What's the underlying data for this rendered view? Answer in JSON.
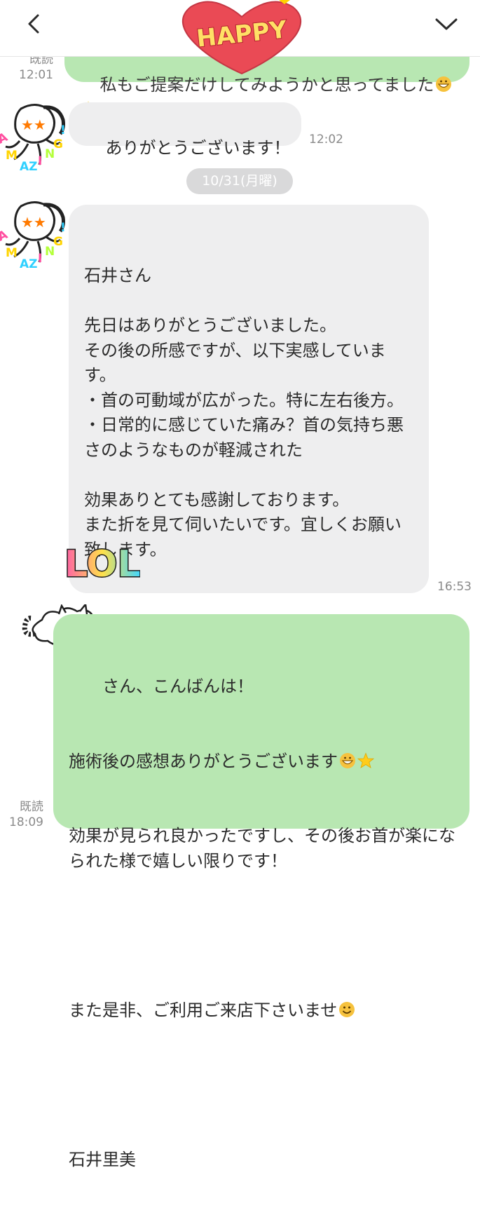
{
  "header": {
    "sticker_text": "HAPPY"
  },
  "messages": {
    "m0": {
      "text": "私もご提案だけしてみようかと思ってました",
      "read": "既読",
      "time": "12:01"
    },
    "m1": {
      "text": "ありがとうございます！",
      "time": "12:02"
    },
    "date_separator": "10/31(月曜)",
    "m2": {
      "text": "石井さん\n\n先日はありがとうございました。\nその後の所感ですが、以下実感しています。\n・首の可動域が広がった。特に左右後方。\n・日常的に感じていた痛み？首の気持ち悪さのようなものが軽減された\n\n効果ありとても感謝しております。\nまた折を見て伺いたいです。宜しくお願い致します。",
      "sticker": "LOL",
      "time": "16:53"
    },
    "m3": {
      "line1": "さん、こんばんは！",
      "line2": "施術後の感想ありがとうございます",
      "line3": "効果が見られ良かったですし、その後お首が楽になられた様で嬉しい限りです！",
      "line4": "また是非、ご利用ご来店下さいませ",
      "signature": "石井里美",
      "read": "既読",
      "time": "18:09"
    }
  },
  "avatar_sticker_text": "AMAZING!",
  "colors": {
    "incoming_bubble": "#eeeeef",
    "outgoing_bubble": "#b8e7b2",
    "meta_text": "#8a8a8a",
    "date_pill": "#d9d9da"
  },
  "icons": {
    "back": "chevron-left-icon",
    "menu": "chevron-down-icon",
    "grin": "grinning-face-icon",
    "star": "star-icon",
    "smile": "smiley-face-icon"
  }
}
